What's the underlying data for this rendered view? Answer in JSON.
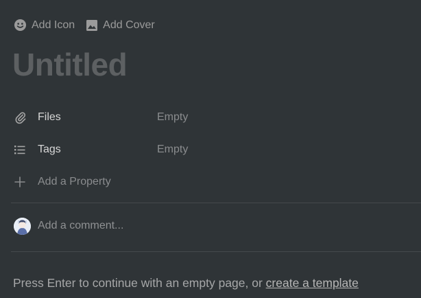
{
  "top_actions": {
    "add_icon_label": "Add Icon",
    "add_icon_icon": "smiley-face-icon",
    "add_cover_label": "Add Cover",
    "add_cover_icon": "image-icon"
  },
  "page": {
    "title": "Untitled"
  },
  "properties": [
    {
      "icon": "paperclip-icon",
      "name": "Files",
      "value": "Empty"
    },
    {
      "icon": "list-icon",
      "name": "Tags",
      "value": "Empty"
    }
  ],
  "add_property": {
    "icon": "plus-icon",
    "label": "Add a Property"
  },
  "comment": {
    "placeholder": "Add a comment..."
  },
  "footer": {
    "prefix": "Press Enter to continue with an empty page, or ",
    "link": "create a template"
  },
  "colors": {
    "background": "#2f3437",
    "title_placeholder": "#5d6062",
    "muted_text": "#8a8c8e"
  }
}
